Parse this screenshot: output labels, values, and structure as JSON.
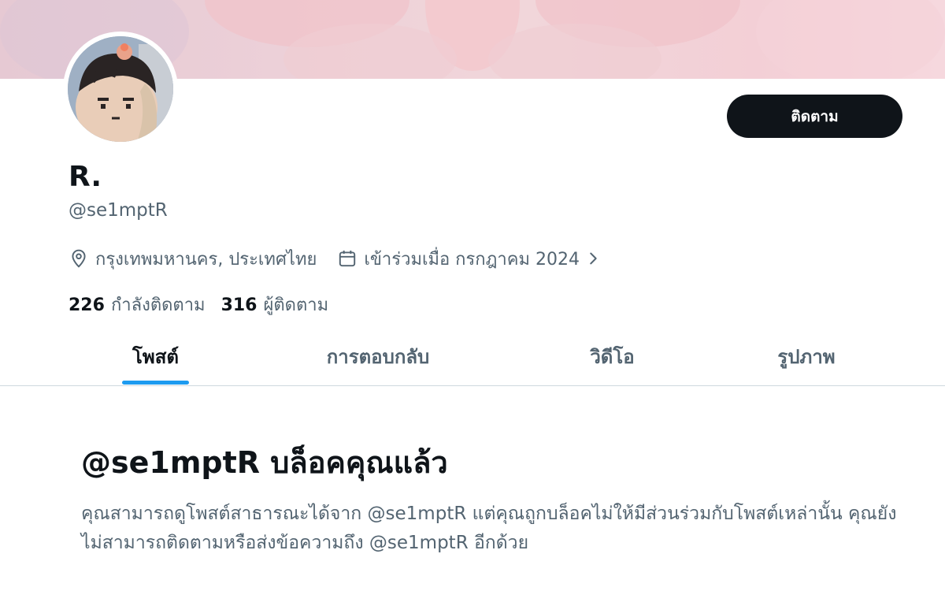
{
  "colors": {
    "text_primary": "#0f1419",
    "text_secondary": "#536471",
    "accent": "#1d9bf0",
    "button_bg": "#0f1419"
  },
  "profile": {
    "display_name": "R.",
    "handle": "@se1mptR",
    "location": "กรุงเทพมหานคร, ประเทศไทย",
    "joined": "เข้าร่วมเมื่อ กรกฎาคม 2024",
    "following_count": "226",
    "following_label": "กำลังติดตาม",
    "followers_count": "316",
    "followers_label": "ผู้ติดตาม"
  },
  "actions": {
    "follow_label": "ติดตาม"
  },
  "icons": {
    "location": "location-pin-icon",
    "calendar": "calendar-icon",
    "chevron": "chevron-right-icon"
  },
  "tabs": [
    {
      "label": "โพสต์",
      "active": true
    },
    {
      "label": "การตอบกลับ",
      "active": false
    },
    {
      "label": "วิดีโอ",
      "active": false
    },
    {
      "label": "รูปภาพ",
      "active": false
    }
  ],
  "blocked_notice": {
    "title": "@se1mptR บล็อคคุณแล้ว",
    "description": "คุณสามารถดูโพสต์สาธารณะได้จาก @se1mptR แต่คุณถูกบล็อคไม่ให้มีส่วนร่วมกับโพสต์เหล่านั้น คุณยังไม่สามารถติดตามหรือส่งข้อความถึง @se1mptR อีกด้วย"
  }
}
